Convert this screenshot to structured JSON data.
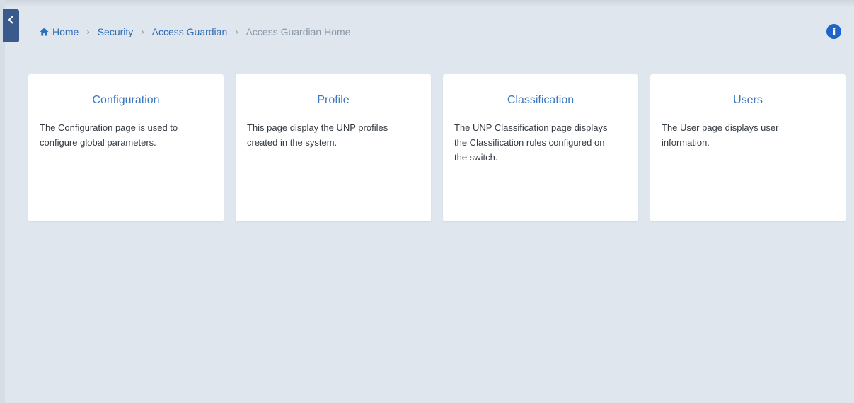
{
  "breadcrumb": {
    "home": "Home",
    "security": "Security",
    "access_guardian": "Access Guardian",
    "current": "Access Guardian Home",
    "separator": "›"
  },
  "icons": {
    "collapse": "chevron-left-icon",
    "home": "home-icon",
    "info": "info-icon"
  },
  "colors": {
    "accent": "#3c78c3",
    "info": "#1f64c8",
    "collapse_tab": "#3a5a8c",
    "background": "#dfe6ee"
  },
  "cards": [
    {
      "title": "Configuration",
      "description": "The Configuration page is used to configure global parameters."
    },
    {
      "title": "Profile",
      "description": "This page display the UNP profiles created in the system."
    },
    {
      "title": "Classification",
      "description": "The UNP Classification page displays the Classification rules configured on the switch."
    },
    {
      "title": "Users",
      "description": "The User page displays user information."
    }
  ]
}
